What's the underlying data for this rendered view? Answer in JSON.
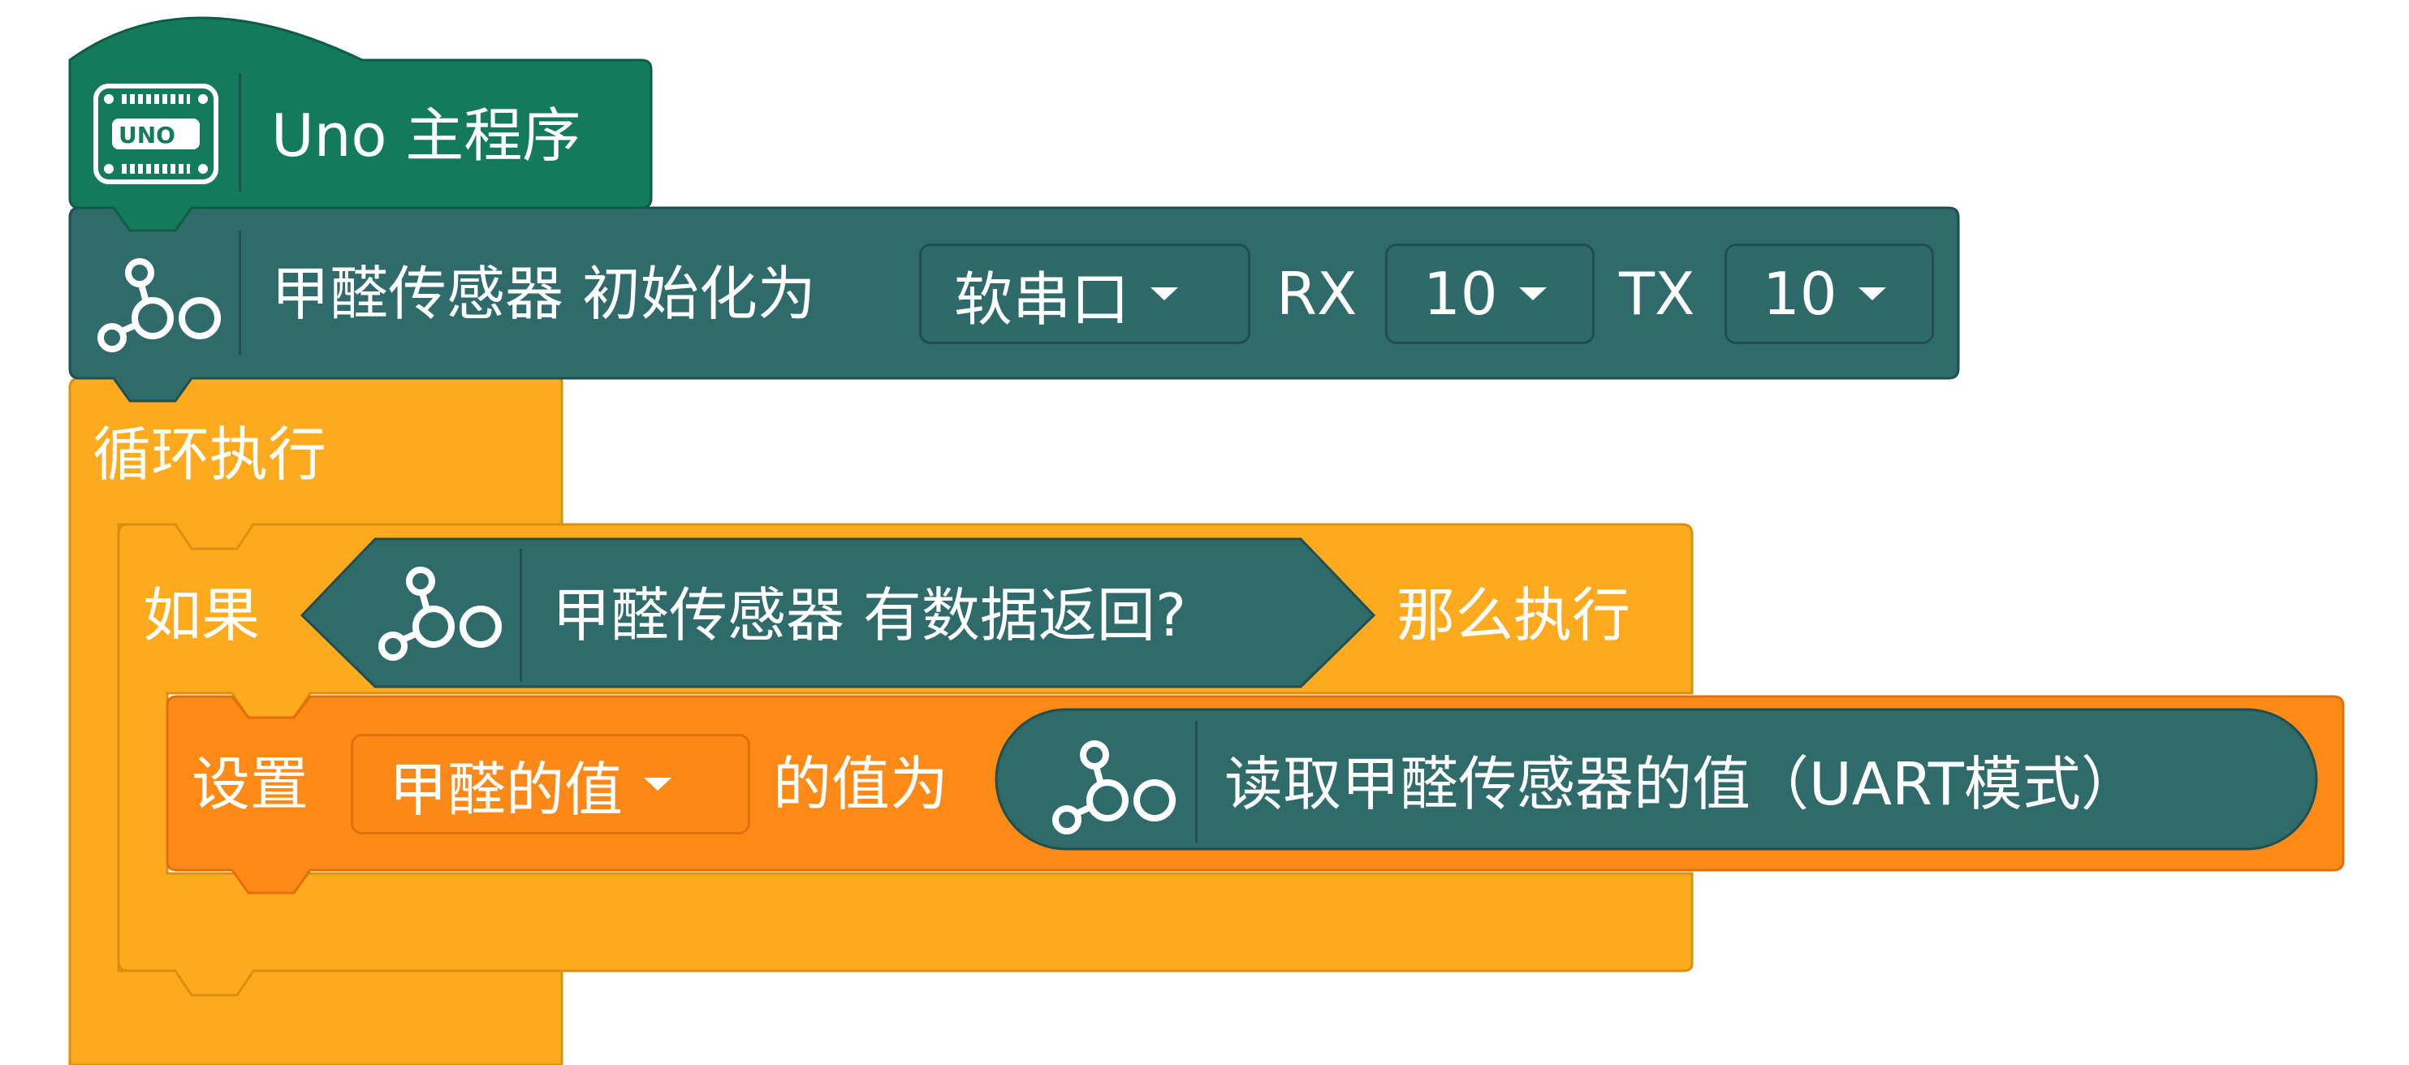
{
  "colors": {
    "hat_green": "#147a5c",
    "sensor_teal": "#306b6b",
    "control_yellow": "#feaa1f",
    "variable_orange": "#fd8917"
  },
  "hat": {
    "label": "Uno 主程序",
    "icon": "uno-board-icon",
    "icon_text": "UNO"
  },
  "init_block": {
    "icon": "sensor-hub-icon",
    "label": "甲醛传感器 初始化为",
    "mode_value": "软串口",
    "rx_label": "RX",
    "rx_value": "10",
    "tx_label": "TX",
    "tx_value": "10"
  },
  "loop_block": {
    "label": "循环执行"
  },
  "if_block": {
    "if_label": "如果",
    "condition": {
      "icon": "sensor-hub-icon",
      "label": "甲醛传感器 有数据返回?"
    },
    "then_label": "那么执行"
  },
  "set_block": {
    "label": "设置",
    "variable": "甲醛的值",
    "value_label": "的值为",
    "reporter": {
      "icon": "sensor-hub-icon",
      "label": "读取甲醛传感器的值（UART模式）"
    }
  }
}
